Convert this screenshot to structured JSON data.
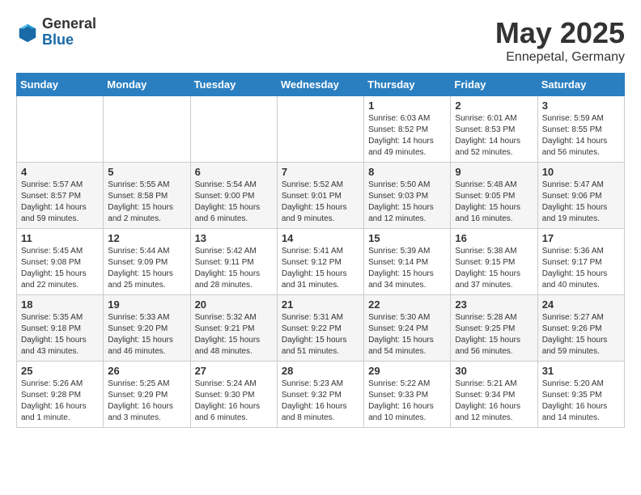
{
  "header": {
    "logo": {
      "general": "General",
      "blue": "Blue"
    },
    "title": "May 2025",
    "location": "Ennepetal, Germany"
  },
  "weekdays": [
    "Sunday",
    "Monday",
    "Tuesday",
    "Wednesday",
    "Thursday",
    "Friday",
    "Saturday"
  ],
  "weeks": [
    [
      {
        "day": "",
        "info": ""
      },
      {
        "day": "",
        "info": ""
      },
      {
        "day": "",
        "info": ""
      },
      {
        "day": "",
        "info": ""
      },
      {
        "day": "1",
        "info": "Sunrise: 6:03 AM\nSunset: 8:52 PM\nDaylight: 14 hours and 49 minutes."
      },
      {
        "day": "2",
        "info": "Sunrise: 6:01 AM\nSunset: 8:53 PM\nDaylight: 14 hours and 52 minutes."
      },
      {
        "day": "3",
        "info": "Sunrise: 5:59 AM\nSunset: 8:55 PM\nDaylight: 14 hours and 56 minutes."
      }
    ],
    [
      {
        "day": "4",
        "info": "Sunrise: 5:57 AM\nSunset: 8:57 PM\nDaylight: 14 hours and 59 minutes."
      },
      {
        "day": "5",
        "info": "Sunrise: 5:55 AM\nSunset: 8:58 PM\nDaylight: 15 hours and 2 minutes."
      },
      {
        "day": "6",
        "info": "Sunrise: 5:54 AM\nSunset: 9:00 PM\nDaylight: 15 hours and 6 minutes."
      },
      {
        "day": "7",
        "info": "Sunrise: 5:52 AM\nSunset: 9:01 PM\nDaylight: 15 hours and 9 minutes."
      },
      {
        "day": "8",
        "info": "Sunrise: 5:50 AM\nSunset: 9:03 PM\nDaylight: 15 hours and 12 minutes."
      },
      {
        "day": "9",
        "info": "Sunrise: 5:48 AM\nSunset: 9:05 PM\nDaylight: 15 hours and 16 minutes."
      },
      {
        "day": "10",
        "info": "Sunrise: 5:47 AM\nSunset: 9:06 PM\nDaylight: 15 hours and 19 minutes."
      }
    ],
    [
      {
        "day": "11",
        "info": "Sunrise: 5:45 AM\nSunset: 9:08 PM\nDaylight: 15 hours and 22 minutes."
      },
      {
        "day": "12",
        "info": "Sunrise: 5:44 AM\nSunset: 9:09 PM\nDaylight: 15 hours and 25 minutes."
      },
      {
        "day": "13",
        "info": "Sunrise: 5:42 AM\nSunset: 9:11 PM\nDaylight: 15 hours and 28 minutes."
      },
      {
        "day": "14",
        "info": "Sunrise: 5:41 AM\nSunset: 9:12 PM\nDaylight: 15 hours and 31 minutes."
      },
      {
        "day": "15",
        "info": "Sunrise: 5:39 AM\nSunset: 9:14 PM\nDaylight: 15 hours and 34 minutes."
      },
      {
        "day": "16",
        "info": "Sunrise: 5:38 AM\nSunset: 9:15 PM\nDaylight: 15 hours and 37 minutes."
      },
      {
        "day": "17",
        "info": "Sunrise: 5:36 AM\nSunset: 9:17 PM\nDaylight: 15 hours and 40 minutes."
      }
    ],
    [
      {
        "day": "18",
        "info": "Sunrise: 5:35 AM\nSunset: 9:18 PM\nDaylight: 15 hours and 43 minutes."
      },
      {
        "day": "19",
        "info": "Sunrise: 5:33 AM\nSunset: 9:20 PM\nDaylight: 15 hours and 46 minutes."
      },
      {
        "day": "20",
        "info": "Sunrise: 5:32 AM\nSunset: 9:21 PM\nDaylight: 15 hours and 48 minutes."
      },
      {
        "day": "21",
        "info": "Sunrise: 5:31 AM\nSunset: 9:22 PM\nDaylight: 15 hours and 51 minutes."
      },
      {
        "day": "22",
        "info": "Sunrise: 5:30 AM\nSunset: 9:24 PM\nDaylight: 15 hours and 54 minutes."
      },
      {
        "day": "23",
        "info": "Sunrise: 5:28 AM\nSunset: 9:25 PM\nDaylight: 15 hours and 56 minutes."
      },
      {
        "day": "24",
        "info": "Sunrise: 5:27 AM\nSunset: 9:26 PM\nDaylight: 15 hours and 59 minutes."
      }
    ],
    [
      {
        "day": "25",
        "info": "Sunrise: 5:26 AM\nSunset: 9:28 PM\nDaylight: 16 hours and 1 minute."
      },
      {
        "day": "26",
        "info": "Sunrise: 5:25 AM\nSunset: 9:29 PM\nDaylight: 16 hours and 3 minutes."
      },
      {
        "day": "27",
        "info": "Sunrise: 5:24 AM\nSunset: 9:30 PM\nDaylight: 16 hours and 6 minutes."
      },
      {
        "day": "28",
        "info": "Sunrise: 5:23 AM\nSunset: 9:32 PM\nDaylight: 16 hours and 8 minutes."
      },
      {
        "day": "29",
        "info": "Sunrise: 5:22 AM\nSunset: 9:33 PM\nDaylight: 16 hours and 10 minutes."
      },
      {
        "day": "30",
        "info": "Sunrise: 5:21 AM\nSunset: 9:34 PM\nDaylight: 16 hours and 12 minutes."
      },
      {
        "day": "31",
        "info": "Sunrise: 5:20 AM\nSunset: 9:35 PM\nDaylight: 16 hours and 14 minutes."
      }
    ]
  ]
}
